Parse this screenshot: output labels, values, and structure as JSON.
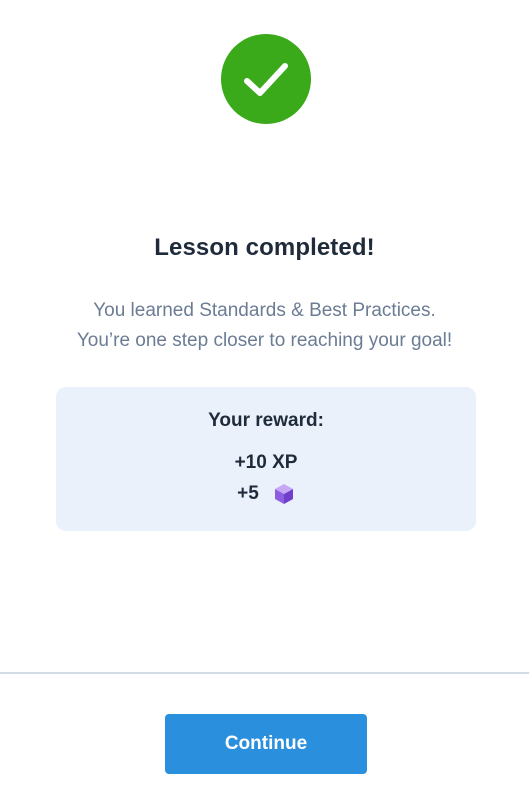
{
  "completion": {
    "icon": "checkmark-icon",
    "color": "#3aaa1a"
  },
  "title": "Lesson completed!",
  "subtitle": {
    "line1": "You learned Standards & Best Practices.",
    "line2": "You’re one step closer to reaching your goal!"
  },
  "reward": {
    "title": "Your reward:",
    "xp": "+10 XP",
    "gems": "+5",
    "gem_icon": "gem-cube-icon"
  },
  "footer": {
    "continue_label": "Continue",
    "accent": "#2a8fdc"
  }
}
